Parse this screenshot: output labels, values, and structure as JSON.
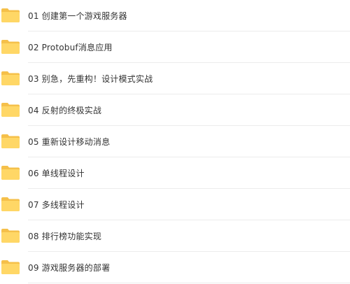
{
  "folders": [
    {
      "label": "01 创建第一个游戏服务器",
      "icon": "folder-icon"
    },
    {
      "label": "02 Protobuf消息应用",
      "icon": "folder-icon"
    },
    {
      "label": "03 别急，先重构！设计模式实战",
      "icon": "folder-icon"
    },
    {
      "label": "04 反射的终极实战",
      "icon": "folder-icon"
    },
    {
      "label": "05 重新设计移动消息",
      "icon": "folder-icon"
    },
    {
      "label": "06 单线程设计",
      "icon": "folder-icon"
    },
    {
      "label": "07 多线程设计",
      "icon": "folder-icon"
    },
    {
      "label": "08 排行榜功能实现",
      "icon": "folder-icon"
    },
    {
      "label": "09 游戏服务器的部署",
      "icon": "folder-icon"
    }
  ],
  "colors": {
    "folder_back": "#F5C04A",
    "folder_front": "#FFD766",
    "text": "#333333",
    "divider": "#ECECEC"
  }
}
